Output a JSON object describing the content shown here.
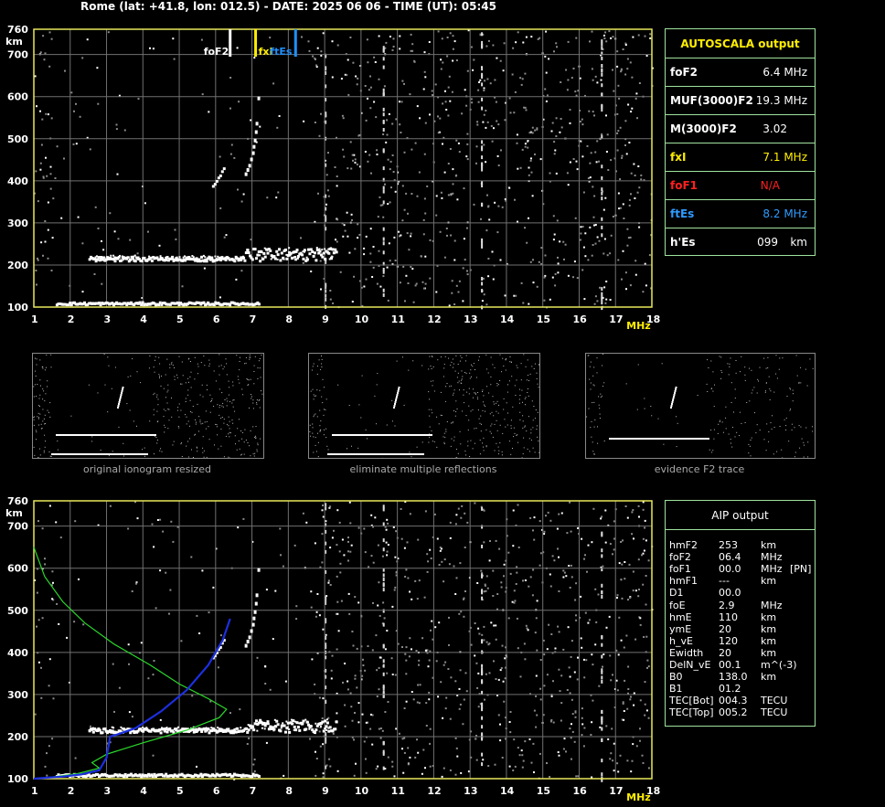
{
  "header": "Rome (lat: +41.8, lon: 012.5) - DATE: 2025 06 06 - TIME (UT): 05:45",
  "colors": {
    "frame": "#e8e85a",
    "grid": "#707070",
    "trace": "#ffffff",
    "profile": "#2bd92b",
    "aip_trace": "#1c2fe0",
    "foF2_marker": "#ffffff",
    "fxI_marker": "#ffee00",
    "ftEs_marker": "#1e90ff",
    "panel_border": "#9fe39f",
    "title_yellow": "#ffee00",
    "foF1_red": "#ff2020",
    "ftEs_blue": "#2f9bff"
  },
  "chart_data": [
    {
      "type": "scatter",
      "name": "ionogram",
      "xlabel": "MHz",
      "ylabel": "km",
      "xlim": [
        1,
        18
      ],
      "ylim": [
        100,
        760
      ],
      "x_ticks": [
        "1",
        "2",
        "3",
        "4",
        "5",
        "6",
        "7",
        "8",
        "9",
        "10",
        "11",
        "12",
        "13",
        "14",
        "15",
        "16",
        "17",
        "18"
      ],
      "y_ticks": [
        "100",
        "200",
        "300",
        "400",
        "500",
        "600",
        "700",
        "760"
      ],
      "grid": true,
      "markers": [
        {
          "label": "foF2",
          "x": 6.4
        },
        {
          "label": "fxI",
          "x": 7.1
        },
        {
          "label": "ftEs",
          "x": 8.2
        }
      ],
      "traces": {
        "es_layer": {
          "x_range": [
            1.6,
            7.2
          ],
          "h": 110
        },
        "f_layer_bottom": {
          "x_range": [
            2.5,
            9.3
          ],
          "h": 215
        },
        "o_trace": [
          [
            5.9,
            390
          ],
          [
            6.0,
            400
          ],
          [
            6.1,
            415
          ],
          [
            6.2,
            430
          ]
        ],
        "x_trace": [
          [
            6.8,
            420
          ],
          [
            6.9,
            440
          ],
          [
            7.0,
            470
          ],
          [
            7.05,
            500
          ],
          [
            7.1,
            540
          ]
        ]
      }
    },
    {
      "type": "line",
      "name": "aip_profile",
      "xlabel": "MHz",
      "ylabel": "km",
      "xlim": [
        1,
        18
      ],
      "ylim": [
        100,
        760
      ],
      "x_ticks": [
        "1",
        "2",
        "3",
        "4",
        "5",
        "6",
        "7",
        "8",
        "9",
        "10",
        "11",
        "12",
        "13",
        "14",
        "15",
        "16",
        "17",
        "18"
      ],
      "y_ticks": [
        "100",
        "200",
        "300",
        "400",
        "500",
        "600",
        "700",
        "760"
      ],
      "grid": true,
      "profile_curve": [
        [
          1.0,
          650
        ],
        [
          1.3,
          580
        ],
        [
          1.8,
          520
        ],
        [
          2.4,
          470
        ],
        [
          3.2,
          420
        ],
        [
          4.2,
          370
        ],
        [
          5.0,
          325
        ],
        [
          5.8,
          290
        ],
        [
          6.3,
          265
        ],
        [
          6.1,
          245
        ],
        [
          5.2,
          215
        ],
        [
          4.0,
          185
        ],
        [
          3.0,
          158
        ],
        [
          2.6,
          138
        ],
        [
          2.8,
          125
        ],
        [
          2.2,
          112
        ],
        [
          1.5,
          104
        ],
        [
          1.0,
          100
        ]
      ],
      "aip_trace": [
        [
          1.0,
          100
        ],
        [
          1.8,
          105
        ],
        [
          2.3,
          110
        ],
        [
          2.8,
          120
        ],
        [
          3.0,
          150
        ],
        [
          3.1,
          200
        ],
        [
          3.3,
          205
        ],
        [
          3.8,
          220
        ],
        [
          4.5,
          260
        ],
        [
          5.2,
          310
        ],
        [
          5.8,
          370
        ],
        [
          6.2,
          430
        ],
        [
          6.4,
          480
        ]
      ]
    }
  ],
  "autoscala": {
    "title": "AUTOSCALA output",
    "rows": [
      {
        "label": "foF2",
        "value": "6.4",
        "unit": "MHz",
        "color": "#ffffff"
      },
      {
        "label": "MUF(3000)F2",
        "value": "19.3",
        "unit": "MHz",
        "color": "#ffffff"
      },
      {
        "label": "M(3000)F2",
        "value": "3.02",
        "unit": "",
        "color": "#ffffff"
      },
      {
        "label": "fxI",
        "value": "7.1",
        "unit": "MHz",
        "color": "#ffee00"
      },
      {
        "label": "foF1",
        "value": "N/A",
        "unit": "",
        "color": "#ff2020"
      },
      {
        "label": "ftEs",
        "value": "8.2",
        "unit": "MHz",
        "color": "#2f9bff"
      },
      {
        "label": "h'Es",
        "value": "099",
        "unit": "km",
        "color": "#ffffff"
      }
    ]
  },
  "thumbnails": [
    {
      "caption": "original ionogram resized"
    },
    {
      "caption": "eliminate multiple reflections"
    },
    {
      "caption": "evidence F2 trace"
    }
  ],
  "aip": {
    "title": "AIP output",
    "rows": [
      {
        "label": "hmF2",
        "value": "253",
        "unit": "km",
        "extra": ""
      },
      {
        "label": "foF2",
        "value": "06.4",
        "unit": "MHz",
        "extra": ""
      },
      {
        "label": "foF1",
        "value": "00.0",
        "unit": "MHz",
        "extra": "[PN]"
      },
      {
        "label": "hmF1",
        "value": "---",
        "unit": "km",
        "extra": ""
      },
      {
        "label": "D1",
        "value": "00.0",
        "unit": "",
        "extra": ""
      },
      {
        "label": "foE",
        "value": "2.9",
        "unit": "MHz",
        "extra": ""
      },
      {
        "label": "hmE",
        "value": "110",
        "unit": "km",
        "extra": ""
      },
      {
        "label": "ymE",
        "value": "20",
        "unit": "km",
        "extra": ""
      },
      {
        "label": "h_vE",
        "value": "120",
        "unit": "km",
        "extra": ""
      },
      {
        "label": "Ewidth",
        "value": "20",
        "unit": "km",
        "extra": ""
      },
      {
        "label": "DelN_vE",
        "value": "00.1",
        "unit": "m^(-3)",
        "extra": ""
      },
      {
        "label": "B0",
        "value": "138.0",
        "unit": "km",
        "extra": ""
      },
      {
        "label": "B1",
        "value": "01.2",
        "unit": "",
        "extra": ""
      },
      {
        "label": "TEC[Bot]",
        "value": "004.3",
        "unit": "TECU",
        "extra": ""
      },
      {
        "label": "TEC[Top]",
        "value": "005.2",
        "unit": "TECU",
        "extra": ""
      }
    ]
  }
}
